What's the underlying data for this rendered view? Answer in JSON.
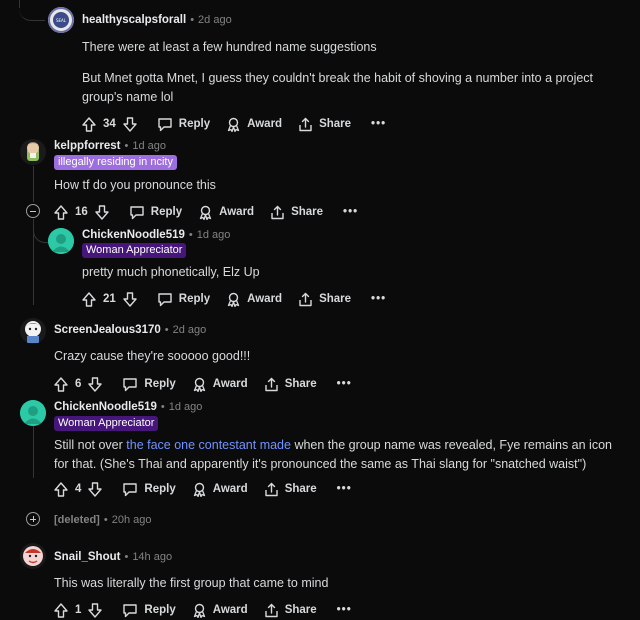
{
  "comments": [
    {
      "author": "healthyscalpsforall",
      "time": "2d ago",
      "body": [
        "There were at least a few hundred name suggestions",
        "But Mnet gotta Mnet, I guess they couldn't break the habit of shoving a number into a project group's name lol"
      ],
      "votes": "34"
    },
    {
      "author": "kelppforrest",
      "time": "1d ago",
      "flair": "illegally residing in ncity",
      "body": [
        "How tf do you pronounce this"
      ],
      "votes": "16"
    },
    {
      "author": "ChickenNoodle519",
      "time": "1d ago",
      "flair": "Woman Appreciator",
      "body": [
        "pretty much phonetically, Elz Up"
      ],
      "votes": "21"
    },
    {
      "author": "ScreenJealous3170",
      "time": "2d ago",
      "body": [
        "Crazy cause they're sooooo good!!!"
      ],
      "votes": "6"
    },
    {
      "author": "ChickenNoodle519",
      "time": "1d ago",
      "flair": "Woman Appreciator",
      "body_prefix": "Still not over ",
      "body_link": "the face one contestant made",
      "body_suffix": " when the group name was revealed, Fye remains an icon for that. (She's Thai and apparently it's pronounced the same as Thai slang for \"snatched waist\")",
      "votes": "4"
    },
    {
      "author": "[deleted]",
      "time": "20h ago"
    },
    {
      "author": "Snail_Shout",
      "time": "14h ago",
      "body": [
        "This was literally the first group that came to mind"
      ],
      "votes": "1"
    }
  ],
  "labels": {
    "reply": "Reply",
    "award": "Award",
    "share": "Share",
    "more": "•••"
  },
  "colors": {
    "background": "#0b0b0b",
    "flair_purple": "#9d6ee0",
    "flair_dark_purple": "#46167a",
    "link": "#7193ff"
  }
}
